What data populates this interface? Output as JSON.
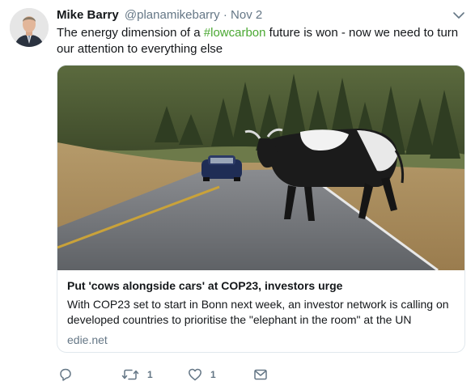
{
  "author": {
    "name": "Mike Barry",
    "handle": "@planamikebarry",
    "separator": "·",
    "date": "Nov 2"
  },
  "tweet": {
    "text_before": "The energy dimension of a ",
    "hashtag": "#lowcarbon",
    "text_after": " future is won - now we need to turn our attention to everything else"
  },
  "card": {
    "title": "Put 'cows alongside cars' at COP23, investors urge",
    "description": "With COP23 set to start in Bonn next week, an investor network is calling on developed countries to prioritise the \"elephant in the room\" at the UN",
    "domain": "edie.net"
  },
  "actions": {
    "reply_icon": "reply-icon",
    "retweet_icon": "retweet-icon",
    "retweet_count": "1",
    "like_icon": "heart-icon",
    "like_count": "1",
    "dm_icon": "envelope-icon"
  },
  "colors": {
    "hashtag": "#4aa832",
    "secondary_text": "#657786",
    "border": "#e1e8ed"
  }
}
